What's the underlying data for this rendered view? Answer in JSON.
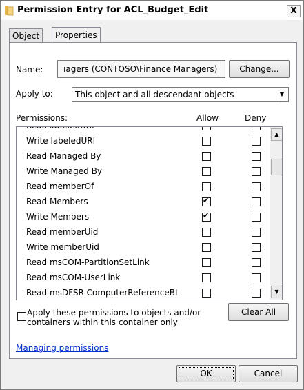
{
  "window": {
    "title": "Permission Entry for ACL_Budget_Edit",
    "close_label": "X"
  },
  "tabs": [
    {
      "label": "Object"
    },
    {
      "label": "Properties"
    }
  ],
  "name_label": "Name:",
  "name_value": "ıagers (CONTOSO\\Finance Managers)",
  "change_button": "Change...",
  "apply_to_label": "Apply to:",
  "apply_to_value": "This object and all descendant objects",
  "permissions": {
    "header": "Permissions:",
    "allow_header": "Allow",
    "deny_header": "Deny",
    "rows": [
      {
        "name": "Read labeledURI",
        "allow": false,
        "deny": false
      },
      {
        "name": "Write labeledURI",
        "allow": false,
        "deny": false
      },
      {
        "name": "Read Managed By",
        "allow": false,
        "deny": false
      },
      {
        "name": "Write Managed By",
        "allow": false,
        "deny": false
      },
      {
        "name": "Read memberOf",
        "allow": false,
        "deny": false
      },
      {
        "name": "Read Members",
        "allow": true,
        "deny": false
      },
      {
        "name": "Write Members",
        "allow": true,
        "deny": false
      },
      {
        "name": "Read memberUid",
        "allow": false,
        "deny": false
      },
      {
        "name": "Write memberUid",
        "allow": false,
        "deny": false
      },
      {
        "name": "Read msCOM-PartitionSetLink",
        "allow": false,
        "deny": false
      },
      {
        "name": "Read msCOM-UserLink",
        "allow": false,
        "deny": false
      },
      {
        "name": "Read msDFSR-ComputerReferenceBL",
        "allow": false,
        "deny": false
      }
    ]
  },
  "apply_checkbox_text": "Apply these permissions to objects and/or containers within this container only",
  "clear_all_button": "Clear All",
  "help_link": "Managing permissions",
  "ok_button": "OK",
  "cancel_button": "Cancel"
}
